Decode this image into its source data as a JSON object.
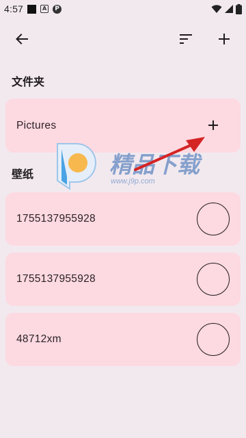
{
  "status_bar": {
    "time": "4:57",
    "icons": [
      "notification-square-icon",
      "a-box-icon",
      "p-circle-icon",
      "wifi-icon",
      "signal-icon",
      "battery-icon"
    ]
  },
  "app_bar": {
    "icons": [
      "arrow-back-icon",
      "sort-icon",
      "add-icon"
    ]
  },
  "folders": {
    "heading": "文件夹",
    "items": [
      {
        "label": "Pictures"
      }
    ]
  },
  "wallpapers": {
    "heading": "壁纸",
    "items": [
      {
        "label": "1755137955928"
      },
      {
        "label": "1755137955928"
      },
      {
        "label": "48712xm"
      }
    ]
  },
  "watermark": {
    "brand": "精品下载",
    "url": "www.j9p.com"
  },
  "colors": {
    "background": "#f2e9ef",
    "card": "#fdd9e1",
    "text": "#1f1a1d",
    "arrow": "#d42424"
  }
}
